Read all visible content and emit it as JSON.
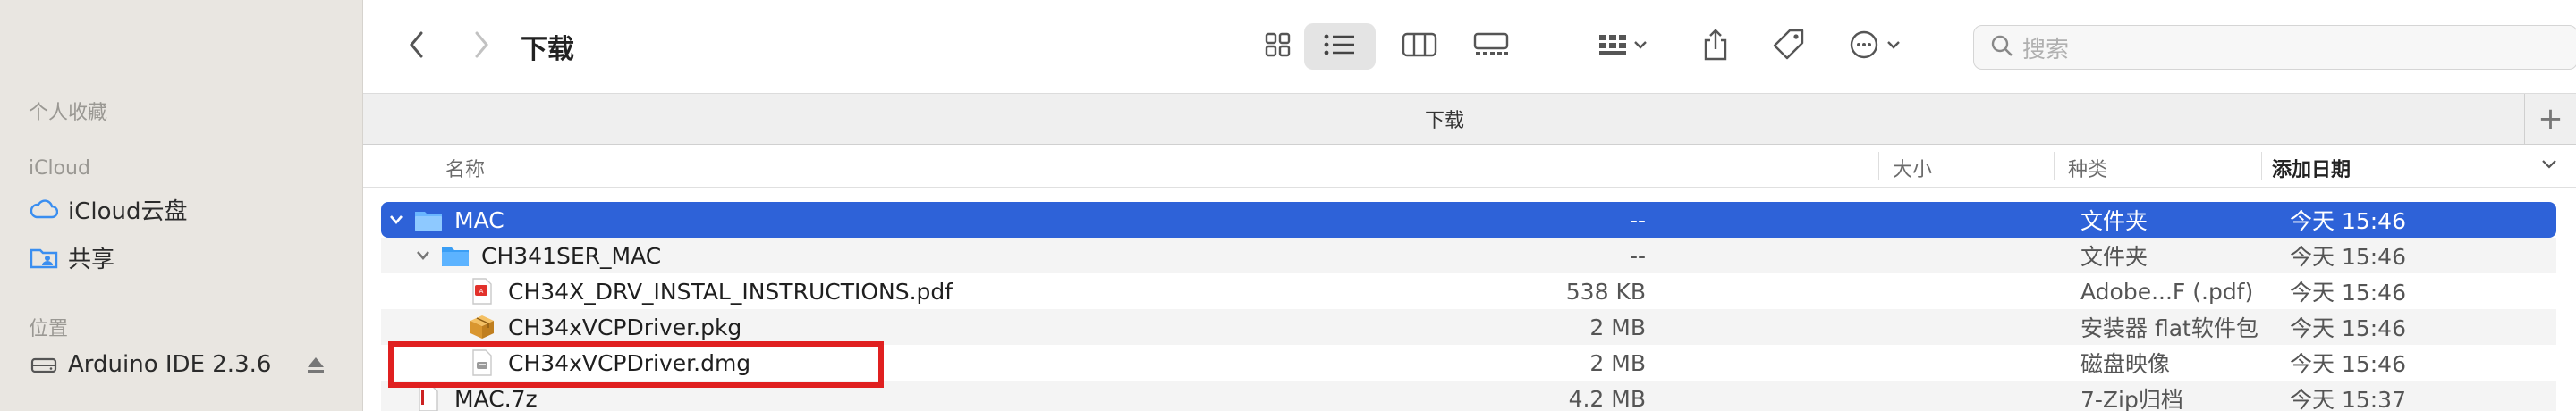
{
  "sidebar": {
    "sections": [
      {
        "label": "个人收藏"
      },
      {
        "label": "iCloud"
      },
      {
        "label": "位置"
      }
    ],
    "items": [
      {
        "label": "iCloud云盘",
        "icon": "cloud-icon"
      },
      {
        "label": "共享",
        "icon": "shared-folder-icon"
      },
      {
        "label": "Arduino IDE 2.3.6",
        "icon": "drive-icon"
      }
    ]
  },
  "toolbar": {
    "title": "下载",
    "search_placeholder": "搜索"
  },
  "tabbar": {
    "title": "下载",
    "add_label": "+"
  },
  "columns": {
    "name": "名称",
    "size": "大小",
    "kind": "种类",
    "date": "添加日期"
  },
  "rows": [
    {
      "name": "MAC",
      "size": "--",
      "kind": "文件夹",
      "date": "今天 15:46"
    },
    {
      "name": "CH341SER_MAC",
      "size": "--",
      "kind": "文件夹",
      "date": "今天 15:46"
    },
    {
      "name": "CH34X_DRV_INSTAL_INSTRUCTIONS.pdf",
      "size": "538 KB",
      "kind": "Adobe...F (.pdf)",
      "date": "今天 15:46"
    },
    {
      "name": "CH34xVCPDriver.pkg",
      "size": "2 MB",
      "kind": "安装器 flat软件包",
      "date": "今天 15:46"
    },
    {
      "name": "CH34xVCPDriver.dmg",
      "size": "2 MB",
      "kind": "磁盘映像",
      "date": "今天 15:46"
    },
    {
      "name": "MAC.7z",
      "size": "4.2 MB",
      "kind": "7-Zip归档",
      "date": "今天 15:37"
    }
  ],
  "colors": {
    "selection": "#2e62d8",
    "highlight_box": "#e02020",
    "folder": "#3a9ef5"
  }
}
